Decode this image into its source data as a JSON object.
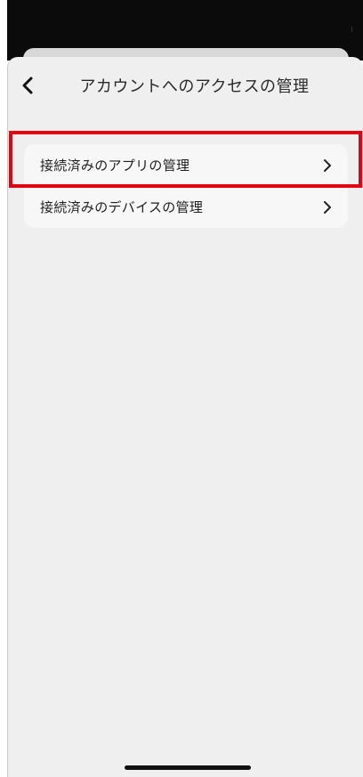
{
  "header": {
    "title": "アカウントへのアクセスの管理",
    "back_icon": "chevron-left-icon"
  },
  "menu": {
    "items": [
      {
        "label": "接続済みのアプリの管理",
        "icon": "chevron-right-icon",
        "highlighted": true
      },
      {
        "label": "接続済みのデバイスの管理",
        "icon": "chevron-right-icon",
        "highlighted": false
      }
    ]
  },
  "colors": {
    "highlight": "#e4000f",
    "sheet_background": "#efefef",
    "card_background": "#f7f7f7",
    "status_bar": "#0b0b0b"
  }
}
